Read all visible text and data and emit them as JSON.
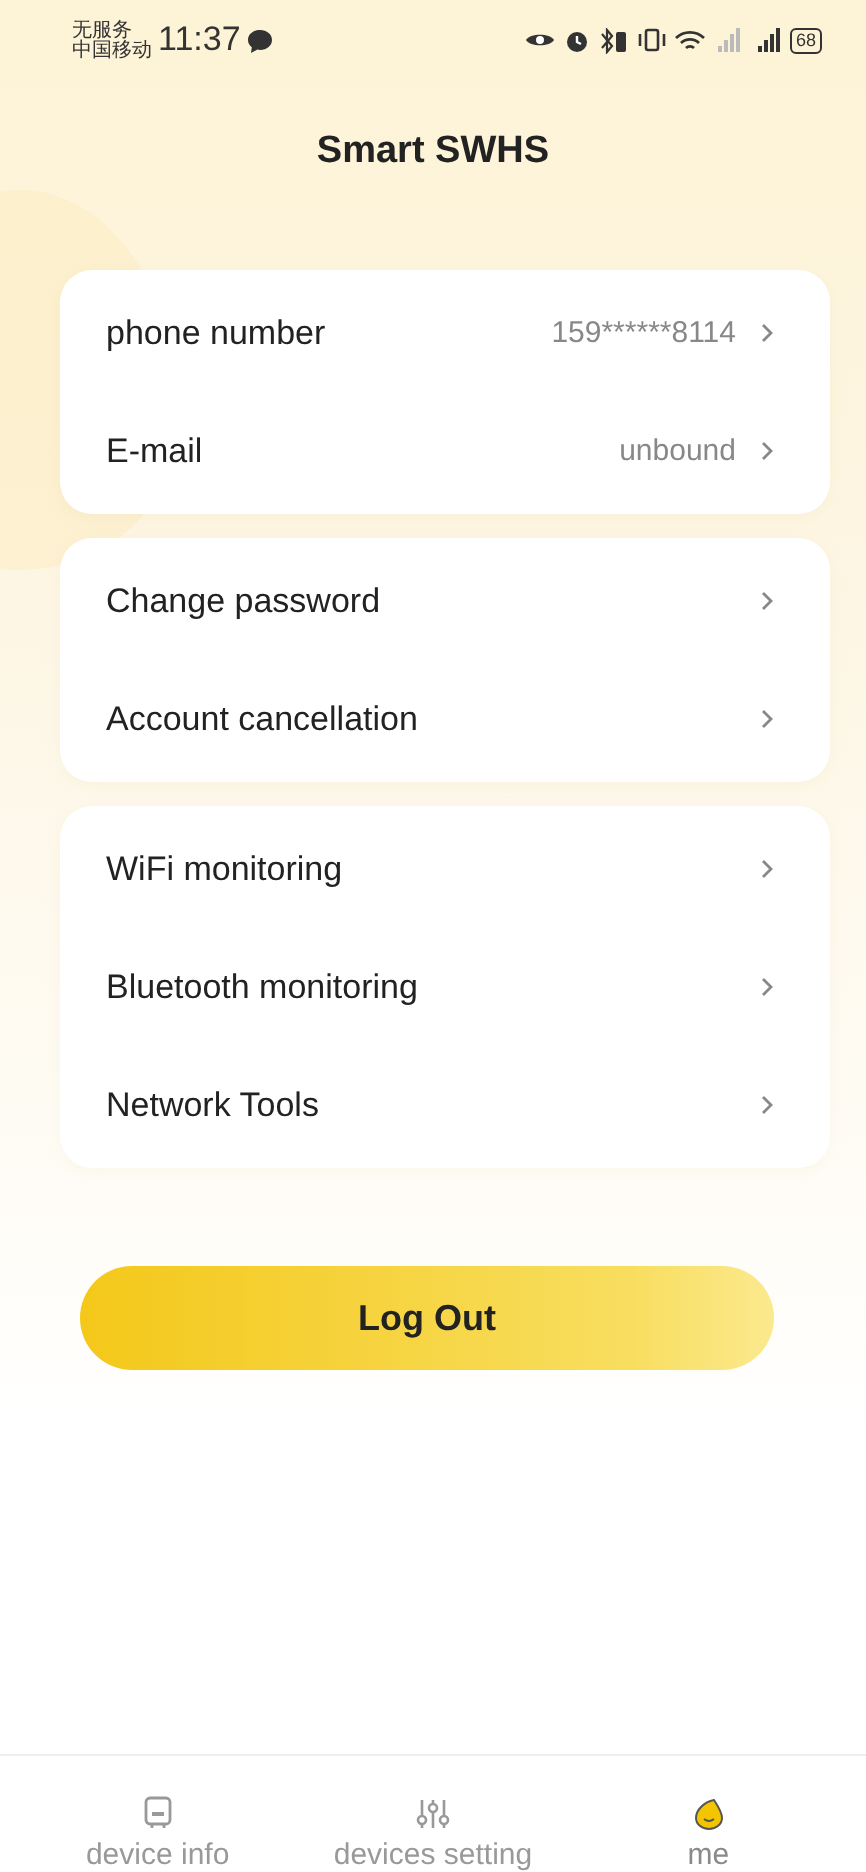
{
  "status_bar": {
    "carrier_lines": [
      "无服务",
      "中国移动"
    ],
    "time": "11:37",
    "battery": "68"
  },
  "header": {
    "title": "Smart SWHS"
  },
  "groups": [
    {
      "rows": [
        {
          "label": "phone number",
          "value": "159******8114"
        },
        {
          "label": "E-mail",
          "value": "unbound"
        }
      ]
    },
    {
      "rows": [
        {
          "label": "Change password"
        },
        {
          "label": "Account cancellation"
        }
      ]
    },
    {
      "rows": [
        {
          "label": "WiFi monitoring"
        },
        {
          "label": "Bluetooth monitoring"
        },
        {
          "label": "Network Tools"
        }
      ]
    }
  ],
  "logout_button": "Log Out",
  "tab_bar": [
    {
      "kind": "device",
      "label": "device info",
      "selected": false
    },
    {
      "kind": "sliders",
      "label": "devices setting",
      "selected": false
    },
    {
      "kind": "drop",
      "label": "me",
      "selected": true
    }
  ]
}
